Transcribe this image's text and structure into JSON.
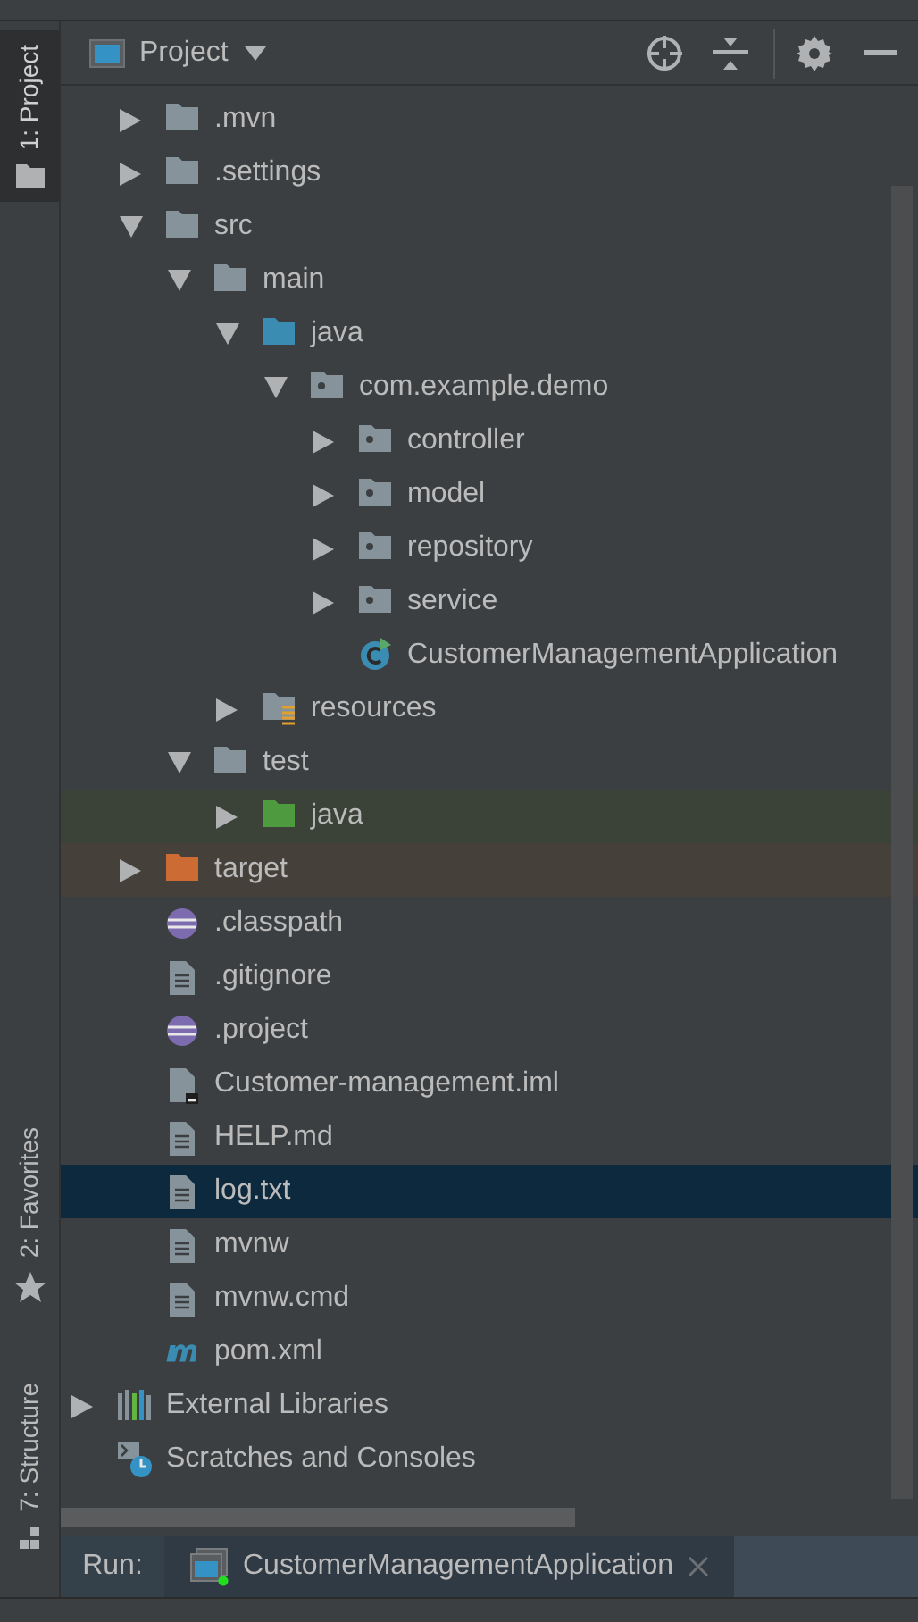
{
  "side_tabs": [
    {
      "label": "1: Project",
      "kind": "project",
      "selected": true
    },
    {
      "label": "2: Favorites",
      "kind": "favorites",
      "selected": false
    },
    {
      "label": "7: Structure",
      "kind": "structure",
      "selected": false
    }
  ],
  "panel": {
    "title": "Project"
  },
  "tree": [
    {
      "label": ".mvn",
      "kind": "folder",
      "expanded": false
    },
    {
      "label": ".settings",
      "kind": "folder",
      "expanded": false
    },
    {
      "label": "src",
      "kind": "folder",
      "expanded": true,
      "children": [
        {
          "label": "main",
          "kind": "folder",
          "expanded": true,
          "children": [
            {
              "label": "java",
              "kind": "source-folder",
              "expanded": true,
              "children": [
                {
                  "label": "com.example.demo",
                  "kind": "package",
                  "expanded": true,
                  "children": [
                    {
                      "label": "controller",
                      "kind": "package",
                      "expanded": false
                    },
                    {
                      "label": "model",
                      "kind": "package",
                      "expanded": false
                    },
                    {
                      "label": "repository",
                      "kind": "package",
                      "expanded": false
                    },
                    {
                      "label": "service",
                      "kind": "package",
                      "expanded": false
                    },
                    {
                      "label": "CustomerManagementApplication",
                      "kind": "class"
                    }
                  ]
                }
              ]
            },
            {
              "label": "resources",
              "kind": "resources-folder",
              "expanded": false
            }
          ]
        },
        {
          "label": "test",
          "kind": "folder",
          "expanded": true,
          "children": [
            {
              "label": "java",
              "kind": "test-folder",
              "expanded": false
            }
          ]
        }
      ]
    },
    {
      "label": "target",
      "kind": "excluded-folder",
      "expanded": false
    },
    {
      "label": ".classpath",
      "kind": "eclipse-file"
    },
    {
      "label": ".gitignore",
      "kind": "text-file"
    },
    {
      "label": ".project",
      "kind": "eclipse-file"
    },
    {
      "label": "Customer-management.iml",
      "kind": "module-file"
    },
    {
      "label": "HELP.md",
      "kind": "text-file"
    },
    {
      "label": "log.txt",
      "kind": "text-file",
      "selected": true
    },
    {
      "label": "mvnw",
      "kind": "text-file"
    },
    {
      "label": "mvnw.cmd",
      "kind": "text-file"
    },
    {
      "label": "pom.xml",
      "kind": "maven-file"
    }
  ],
  "other_roots": [
    {
      "label": "External Libraries",
      "kind": "libraries",
      "expanded": false
    },
    {
      "label": "Scratches and Consoles",
      "kind": "scratches"
    }
  ],
  "run_bar": {
    "label": "Run:",
    "tabs": [
      {
        "label": "CustomerManagementApplication",
        "selected": true
      }
    ]
  }
}
